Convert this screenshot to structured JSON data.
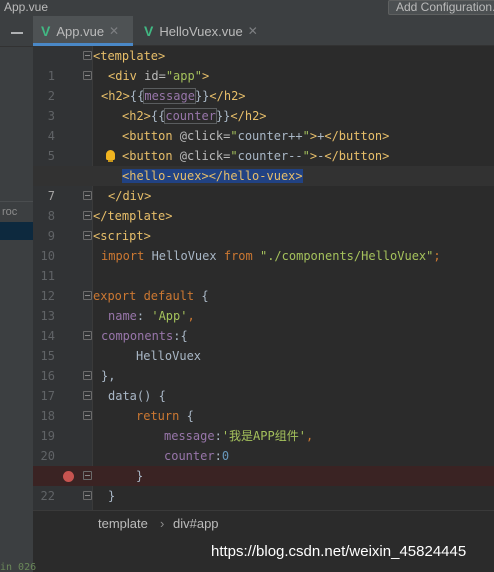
{
  "titlebar": {
    "file_name": "App.vue",
    "add_config_label": "Add Configuration..."
  },
  "sidebar": {
    "partial_label": "roc"
  },
  "tabs": [
    {
      "label": "App.vue",
      "icon": "vue-icon",
      "active": true
    },
    {
      "label": "HelloVuex.vue",
      "icon": "vue-icon",
      "active": false
    }
  ],
  "editor": {
    "lines": [
      {
        "n": "1"
      },
      {
        "n": "2"
      },
      {
        "n": "3"
      },
      {
        "n": "4"
      },
      {
        "n": "5"
      },
      {
        "n": "6"
      },
      {
        "n": "7"
      },
      {
        "n": "8"
      },
      {
        "n": "9"
      },
      {
        "n": "10"
      },
      {
        "n": "11"
      },
      {
        "n": "12"
      },
      {
        "n": "13"
      },
      {
        "n": "14"
      },
      {
        "n": "15"
      },
      {
        "n": "16"
      },
      {
        "n": "17"
      },
      {
        "n": "18"
      },
      {
        "n": "19"
      },
      {
        "n": "20"
      },
      {
        "n": "21"
      },
      {
        "n": "22"
      },
      {
        "n": "23"
      }
    ],
    "code": {
      "l1_tag": "<template>",
      "l2_open": "<div ",
      "l2_attr": "id=",
      "l2_val": "\"app\"",
      "l2_close": ">",
      "l3_open": "<h2>",
      "l3_mustache_o": "{{",
      "l3_var": "message",
      "l3_mustache_c": "}}",
      "l3_close": "</h2>",
      "l4_open": "<h2>",
      "l4_mustache_o": "{{",
      "l4_var": "counter",
      "l4_mustache_c": "}}",
      "l4_close": "</h2>",
      "l5_open": "<button ",
      "l5_attr": "@click=",
      "l5_q1": "\"",
      "l5_expr": "counter++",
      "l5_q2": "\"",
      "l5_gt": ">",
      "l5_text": "+",
      "l5_close": "</button>",
      "l6_open": "<button ",
      "l6_attr": "@click=",
      "l6_q1": "\"",
      "l6_expr": "counter--",
      "l6_q2": "\"",
      "l6_gt": ">",
      "l6_text": "-",
      "l6_close": "</button>",
      "l7_tag": "<hello-vuex></hello-vuex>",
      "l8_tag": "</div>",
      "l9_tag": "</template>",
      "l10_tag": "<script>",
      "l11_kw": "import",
      "l11_name": " HelloVuex ",
      "l11_from": "from",
      "l11_path": " \"./components/HelloVuex\"",
      "l11_semi": ";",
      "l13_kw1": "export",
      "l13_kw2": " default",
      "l13_brace": " {",
      "l14_prop": "name",
      "l14_colon": ": ",
      "l14_val": "'App'",
      "l14_comma": ",",
      "l15_prop": "components",
      "l15_rest": ":{",
      "l16_name": "HelloVuex",
      "l17_close": "},",
      "l18_fn": "data",
      "l18_rest": "() {",
      "l19_kw": "return",
      "l19_brace": " {",
      "l20_prop": "message",
      "l20_colon": ":",
      "l20_val": "'我是APP组件'",
      "l20_comma": ",",
      "l21_prop": "counter",
      "l21_colon": ":",
      "l21_val": "0",
      "l22_close": "}",
      "l23_close": "}"
    }
  },
  "breadcrumb": {
    "item1": "template",
    "separator": "›",
    "item2": "div#app"
  },
  "watermark": "https://blog.csdn.net/weixin_45824445",
  "bottom_partial": "in 026"
}
